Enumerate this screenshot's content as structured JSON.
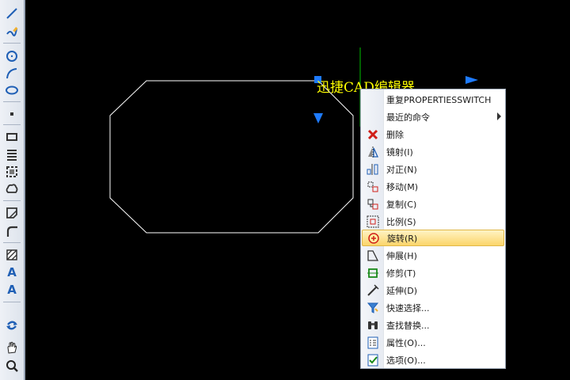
{
  "canvas": {
    "text": "迅捷CAD编辑器",
    "text_color": "#ffff00",
    "background": "#000000",
    "shape_stroke": "#ffffff",
    "grip_color": "#1e7bff",
    "axis_color": "#00c000"
  },
  "toolbar": {
    "tools": [
      {
        "icon": "line-icon"
      },
      {
        "icon": "pencil-polyline-icon"
      },
      {
        "icon": "circle-icon"
      },
      {
        "icon": "arc-icon"
      },
      {
        "icon": "ellipse-icon"
      },
      {
        "icon": "point-icon"
      },
      {
        "icon": "rectangle-icon"
      },
      {
        "icon": "hatch-lines-icon"
      },
      {
        "icon": "region-icon"
      },
      {
        "icon": "cloud-icon"
      },
      {
        "icon": "insert-block-icon"
      },
      {
        "icon": "fillet-icon"
      },
      {
        "icon": "hatch-icon"
      },
      {
        "icon": "multiline-text-icon",
        "text": "A"
      },
      {
        "icon": "single-text-icon",
        "text": "A"
      },
      {
        "icon": "undo-redo-icon"
      },
      {
        "icon": "pan-hand-icon"
      },
      {
        "icon": "zoom-icon"
      }
    ]
  },
  "context_menu": {
    "items": [
      {
        "label": "重复PROPERTIESSWITCH",
        "icon": ""
      },
      {
        "label": "最近的命令",
        "icon": "",
        "submenu": true
      },
      {
        "label": "删除",
        "icon": "delete-x-icon"
      },
      {
        "label": "镜射(I)",
        "icon": "mirror-icon"
      },
      {
        "label": "对正(N)",
        "icon": "align-icon"
      },
      {
        "label": "移动(M)",
        "icon": "move-icon"
      },
      {
        "label": "复制(C)",
        "icon": "copy-icon"
      },
      {
        "label": "比例(S)",
        "icon": "scale-icon"
      },
      {
        "label": "旋转(R)",
        "icon": "rotate-icon",
        "highlighted": true
      },
      {
        "label": "伸展(H)",
        "icon": "stretch-icon"
      },
      {
        "label": "修剪(T)",
        "icon": "trim-icon"
      },
      {
        "label": "延伸(D)",
        "icon": "extend-icon"
      },
      {
        "label": "快速选择...",
        "icon": "quick-select-funnel-icon"
      },
      {
        "label": "查找替换...",
        "icon": "find-binoculars-icon"
      },
      {
        "label": "属性(O)...",
        "icon": "properties-icon"
      },
      {
        "label": "选项(O)...",
        "icon": "options-icon"
      }
    ]
  }
}
